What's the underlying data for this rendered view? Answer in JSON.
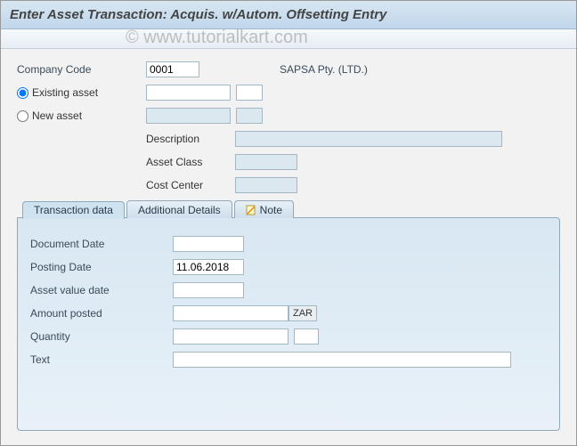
{
  "title": "Enter Asset Transaction: Acquis. w/Autom. Offsetting Entry",
  "watermark": "© www.tutorialkart.com",
  "header": {
    "company_code_label": "Company Code",
    "company_code_value": "0001",
    "company_name": "SAPSA Pty. (LTD.)",
    "existing_asset_label": "Existing asset",
    "new_asset_label": "New asset",
    "existing_asset_checked": true,
    "existing_main_value": "",
    "existing_sub_value": "",
    "new_main_value": "",
    "new_sub_value": "",
    "description_label": "Description",
    "description_value": "",
    "asset_class_label": "Asset Class",
    "asset_class_value": "",
    "cost_center_label": "Cost Center",
    "cost_center_value": ""
  },
  "tabs": {
    "t1": "Transaction data",
    "t2": "Additional Details",
    "t3": "Note"
  },
  "txn": {
    "document_date_label": "Document Date",
    "document_date_value": "",
    "posting_date_label": "Posting Date",
    "posting_date_value": "11.06.2018",
    "asset_value_date_label": "Asset value date",
    "asset_value_date_value": "",
    "amount_posted_label": "Amount posted",
    "amount_posted_value": "",
    "currency": "ZAR",
    "quantity_label": "Quantity",
    "quantity_value": "",
    "quantity_unit_value": "",
    "text_label": "Text",
    "text_value": ""
  }
}
